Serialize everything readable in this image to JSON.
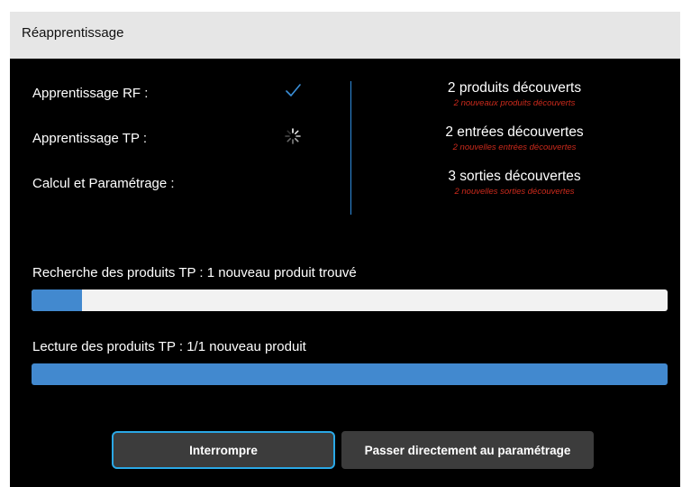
{
  "window": {
    "title": "Réapprentissage"
  },
  "status_rows": [
    {
      "label": "Apprentissage RF :",
      "state": "done",
      "icon": "checkmark-icon"
    },
    {
      "label": "Apprentissage TP :",
      "state": "in-progress",
      "icon": "spinner-icon"
    },
    {
      "label": "Calcul et Paramétrage :",
      "state": "pending",
      "icon": ""
    }
  ],
  "stats": [
    {
      "main": "2 produits découverts",
      "sub": "2 nouveaux produits découverts"
    },
    {
      "main": "2 entrées découvertes",
      "sub": "2 nouvelles entrées découvertes"
    },
    {
      "main": "3 sorties découvertes",
      "sub": "2 nouvelles sorties découvertes"
    }
  ],
  "progress": [
    {
      "label": "Recherche des produits TP : 1 nouveau produit trouvé",
      "percent": 8
    },
    {
      "label": "Lecture des produits TP : 1/1 nouveau produit",
      "percent": 100
    }
  ],
  "buttons": {
    "interrupt": "Interrompre",
    "skip": "Passer directement au paramétrage"
  },
  "colors": {
    "accent": "#2f8de0",
    "progress_fill": "#4289cf",
    "sub_text": "#cc2a1c",
    "focus_ring": "#2aa8e6"
  }
}
